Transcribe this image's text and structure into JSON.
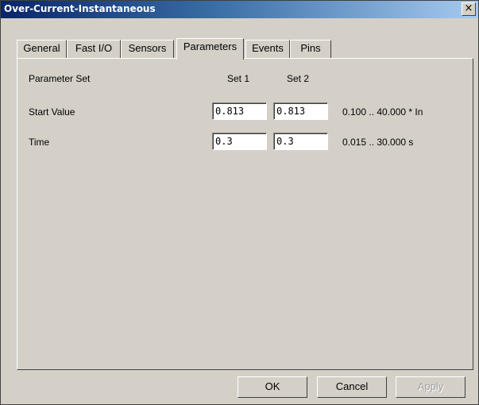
{
  "window": {
    "title": "Over-Current-Instantaneous",
    "close_glyph": "×"
  },
  "tabs": [
    {
      "label": "General"
    },
    {
      "label": "Fast I/O"
    },
    {
      "label": "Sensors"
    },
    {
      "label": "Parameters",
      "active": true
    },
    {
      "label": "Events"
    },
    {
      "label": "Pins"
    }
  ],
  "parameters": {
    "header_label": "Parameter Set",
    "set1_label": "Set 1",
    "set2_label": "Set 2",
    "rows": [
      {
        "label": "Start Value",
        "set1": "0.813",
        "set2": "0.813",
        "range": "0.100 .. 40.000 * In"
      },
      {
        "label": "Time",
        "set1": "0.3",
        "set2": "0.3",
        "range": "0.015 .. 30.000 s"
      }
    ]
  },
  "buttons": {
    "ok": "OK",
    "cancel": "Cancel",
    "apply": "Apply"
  }
}
